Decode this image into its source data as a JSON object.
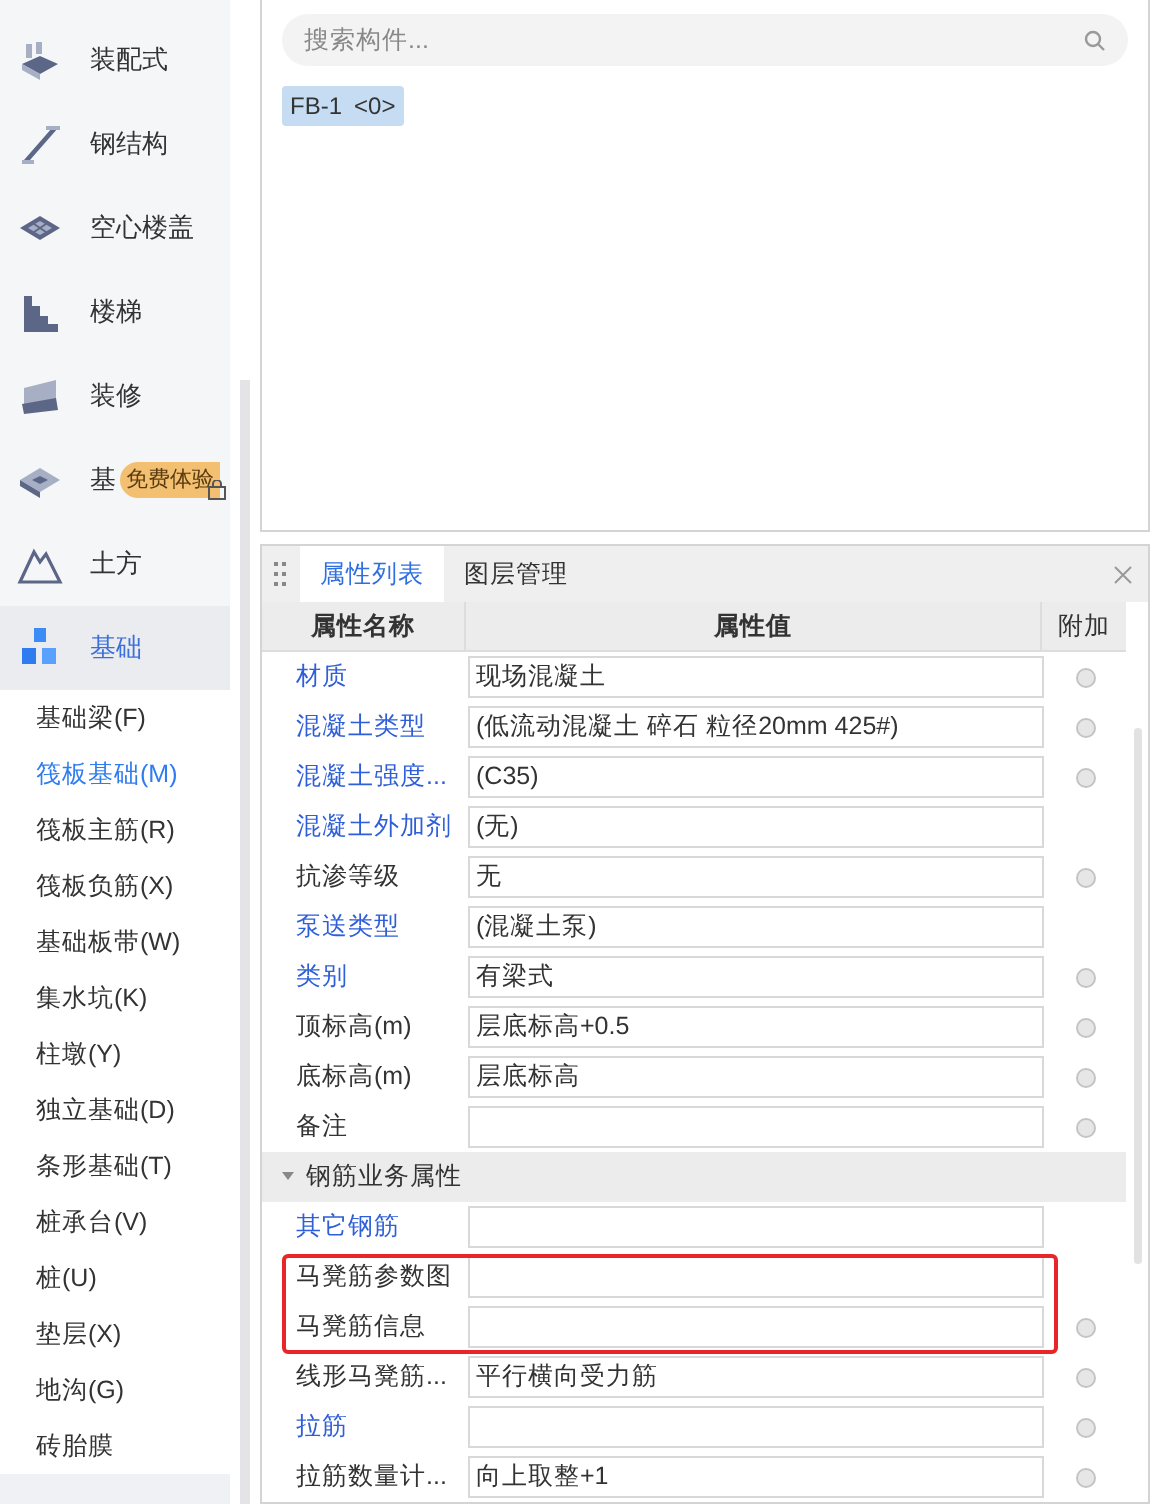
{
  "sidebar": {
    "categories": [
      {
        "label": "装配式",
        "selected": false
      },
      {
        "label": "钢结构",
        "selected": false
      },
      {
        "label": "空心楼盖",
        "selected": false
      },
      {
        "label": "楼梯",
        "selected": false
      },
      {
        "label": "装修",
        "selected": false
      },
      {
        "label": "基",
        "selected": false,
        "badge": "免费体验",
        "locked": true
      },
      {
        "label": "土方",
        "selected": false
      },
      {
        "label": "基础",
        "selected": true
      }
    ],
    "items": [
      {
        "label": "基础梁(F)",
        "selected": false
      },
      {
        "label": "筏板基础(M)",
        "selected": true
      },
      {
        "label": "筏板主筋(R)",
        "selected": false
      },
      {
        "label": "筏板负筋(X)",
        "selected": false
      },
      {
        "label": "基础板带(W)",
        "selected": false
      },
      {
        "label": "集水坑(K)",
        "selected": false
      },
      {
        "label": "柱墩(Y)",
        "selected": false
      },
      {
        "label": "独立基础(D)",
        "selected": false
      },
      {
        "label": "条形基础(T)",
        "selected": false
      },
      {
        "label": "桩承台(V)",
        "selected": false
      },
      {
        "label": "桩(U)",
        "selected": false
      },
      {
        "label": "垫层(X)",
        "selected": false
      },
      {
        "label": "地沟(G)",
        "selected": false
      },
      {
        "label": "砖胎膜",
        "selected": false
      }
    ]
  },
  "component_list": {
    "search": {
      "placeholder": "搜索构件..."
    },
    "items": [
      {
        "label": "FB-1",
        "count": "<0>",
        "selected": true
      }
    ]
  },
  "properties": {
    "tabs": [
      {
        "label": "属性列表",
        "selected": true
      },
      {
        "label": "图层管理",
        "selected": false
      }
    ],
    "columns": [
      "属性名称",
      "属性值",
      "附加"
    ],
    "rows": [
      {
        "kind": "row",
        "name": "材质",
        "link": true,
        "value": "现场混凝土",
        "attach": true
      },
      {
        "kind": "row",
        "name": "混凝土类型",
        "link": true,
        "value": "(低流动混凝土 碎石 粒径20mm  425#)",
        "attach": true
      },
      {
        "kind": "row",
        "name": "混凝土强度...",
        "link": true,
        "value": "(C35)",
        "attach": true
      },
      {
        "kind": "row",
        "name": "混凝土外加剂",
        "link": true,
        "value": "(无)",
        "attach": false
      },
      {
        "kind": "row",
        "name": "抗渗等级",
        "link": false,
        "value": "无",
        "attach": true
      },
      {
        "kind": "row",
        "name": "泵送类型",
        "link": true,
        "value": "(混凝土泵)",
        "attach": false
      },
      {
        "kind": "row",
        "name": "类别",
        "link": true,
        "value": "有梁式",
        "attach": true
      },
      {
        "kind": "row",
        "name": "顶标高(m)",
        "link": false,
        "value": "层底标高+0.5",
        "attach": true
      },
      {
        "kind": "row",
        "name": "底标高(m)",
        "link": false,
        "value": "层底标高",
        "attach": true
      },
      {
        "kind": "row",
        "name": "备注",
        "link": false,
        "attach": true
      },
      {
        "kind": "section",
        "name": "钢筋业务属性",
        "expanded": true
      },
      {
        "kind": "row",
        "name": "其它钢筋",
        "link": true,
        "attach": false
      },
      {
        "kind": "highlight",
        "children": [
          {
            "kind": "row",
            "name": "马凳筋参数图",
            "link": false,
            "attach": false
          },
          {
            "kind": "row",
            "name": "马凳筋信息",
            "link": false,
            "attach": true
          }
        ]
      },
      {
        "kind": "row",
        "name": "线形马凳筋...",
        "link": false,
        "value": "平行横向受力筋",
        "attach": true
      },
      {
        "kind": "row",
        "name": "拉筋",
        "link": true,
        "attach": true
      },
      {
        "kind": "row",
        "name": "拉筋数量计...",
        "link": false,
        "value": "向上取整+1",
        "attach": true
      }
    ]
  }
}
